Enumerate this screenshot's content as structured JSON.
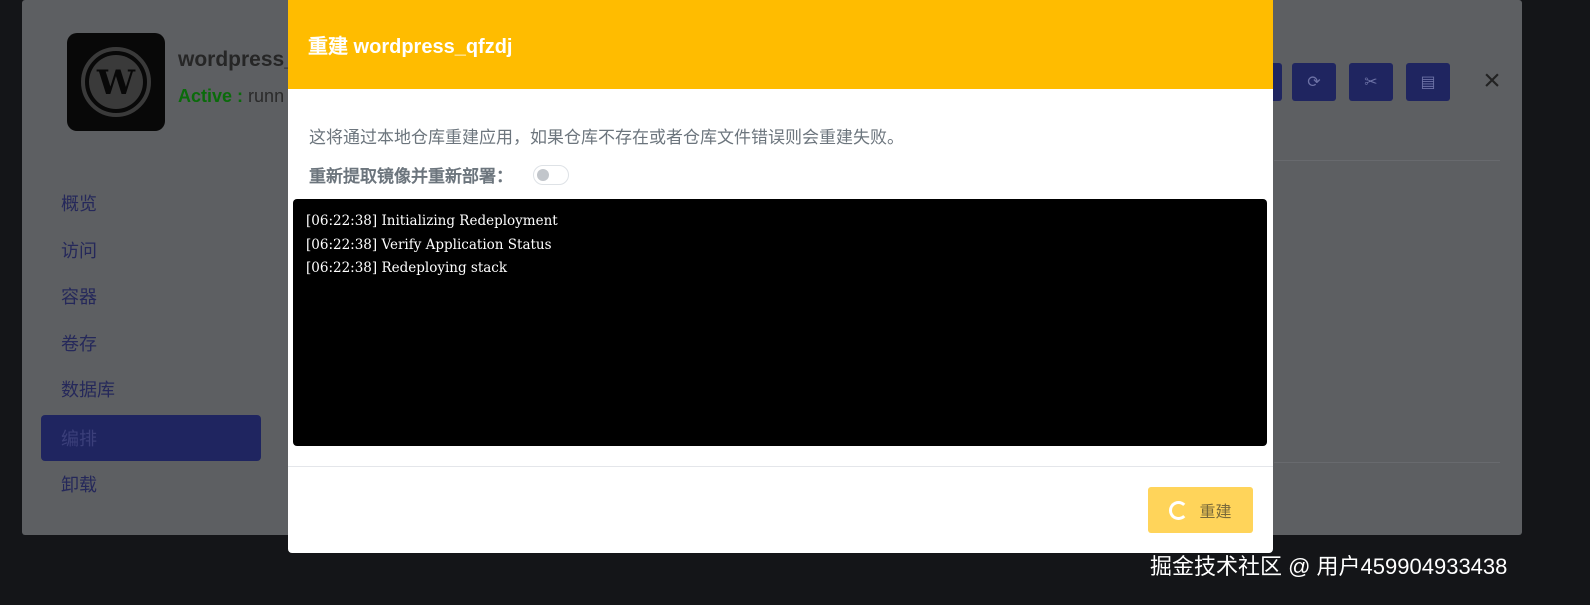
{
  "background_app": {
    "name": "wordpress_",
    "status_label": "Active :",
    "status_value": "runn",
    "close_glyph": "×",
    "toolbar_icons": [
      "gear-icon",
      "refresh-icon",
      "tools-icon",
      "document-icon"
    ],
    "menu": [
      {
        "label": "概览"
      },
      {
        "label": "访问"
      },
      {
        "label": "容器"
      },
      {
        "label": "卷存"
      },
      {
        "label": "数据库"
      },
      {
        "label": "编排"
      },
      {
        "label": "卸载"
      }
    ]
  },
  "modal": {
    "title": "重建 wordpress_qfzdj",
    "description": "这将通过本地仓库重建应用，如果仓库不存在或者仓库文件错误则会重建失败。",
    "toggle_label": "重新提取镜像并重新部署：",
    "toggle_on": false,
    "log_lines": [
      "[06:22:38] Initializing Redeployment",
      "[06:22:38] Verify Application Status",
      "[06:22:38] Redeploying stack"
    ],
    "rebuild_button_label": "重建",
    "accent_color": "#ffbc00"
  },
  "watermark": "掘金技术社区 @ 用户459904933438"
}
